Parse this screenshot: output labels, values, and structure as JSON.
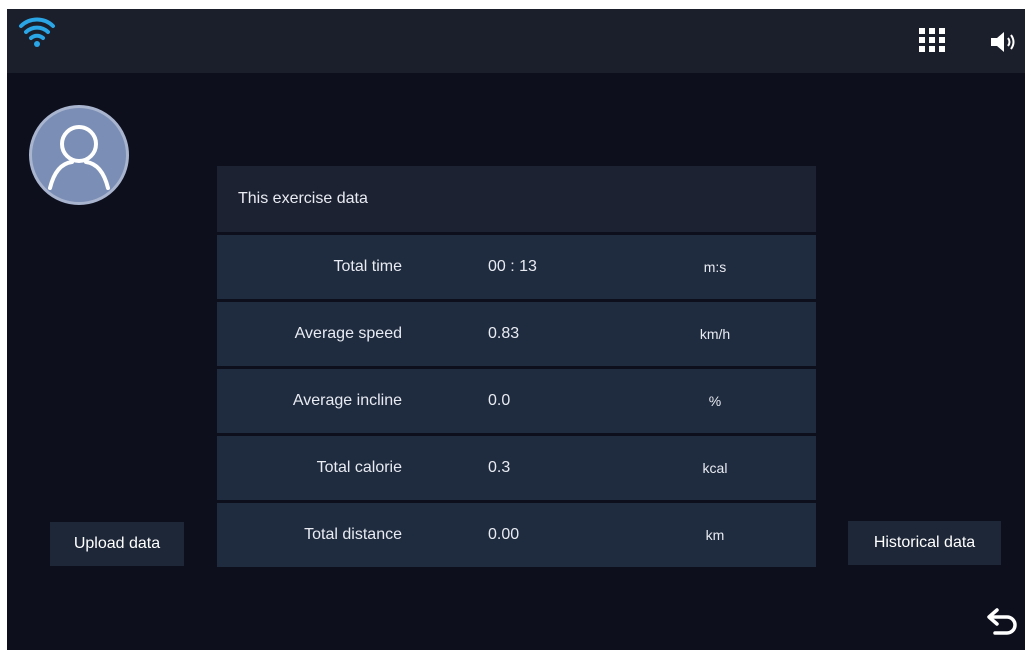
{
  "status_bar": {
    "icons": [
      "wifi-icon",
      "apps-grid-icon",
      "volume-icon"
    ],
    "wifi_color": "#2aa6e6"
  },
  "user": {
    "avatar_icon": "user-avatar-icon"
  },
  "panel": {
    "title": "This exercise data",
    "rows": [
      {
        "label": "Total time",
        "value": "00 : 13",
        "unit": "m:s"
      },
      {
        "label": "Average speed",
        "value": "0.83",
        "unit": "km/h"
      },
      {
        "label": "Average incline",
        "value": "0.0",
        "unit": "%"
      },
      {
        "label": "Total calorie",
        "value": "0.3",
        "unit": "kcal"
      },
      {
        "label": "Total distance",
        "value": "0.00",
        "unit": "km"
      }
    ]
  },
  "buttons": {
    "upload": "Upload data",
    "history": "Historical data"
  },
  "nav": {
    "back_icon": "back-arrow-icon"
  },
  "colors": {
    "background": "#0d0f1d",
    "topbar": "#1b1e2b",
    "row": "#1f2b3e",
    "header": "#1d2232"
  }
}
